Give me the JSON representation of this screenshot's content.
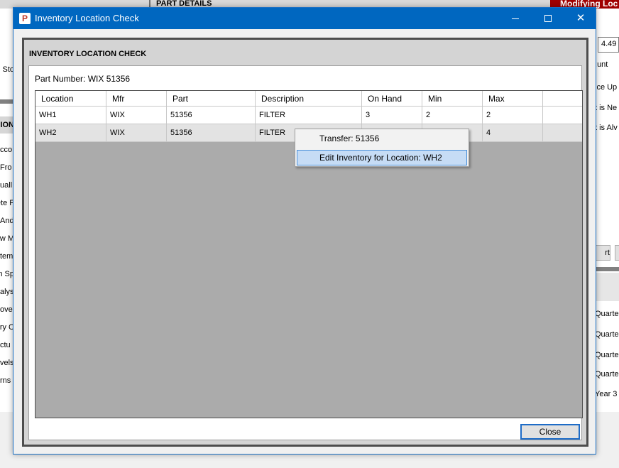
{
  "background": {
    "part_details_label": "PART DETAILS",
    "modifying_label": "Modifying Loc",
    "left_top_fragment": "o Sto",
    "left_header_fragment": "ION",
    "left_items": [
      "cco",
      "Fro",
      "uall",
      "ete F",
      "And",
      "w M",
      "tem",
      "n Sp",
      "alys",
      "ove",
      "ry C",
      "ctu",
      "vels",
      "rns"
    ],
    "right_input_value": "4.49",
    "right_items_top": [
      "unt:",
      "ice Up",
      "t is Ne",
      "t is Alv"
    ],
    "right_button_fragment": "rt",
    "right_items_bottom": [
      "Quarte",
      "Quarte",
      "Quarte",
      "Quarte",
      "Year 3"
    ]
  },
  "window": {
    "title": "Inventory Location Check",
    "icon_letter": "P",
    "minimize_label": "",
    "maximize_label": "",
    "close_glyph": "✕"
  },
  "dialog": {
    "section_title": "INVENTORY LOCATION CHECK",
    "part_number_label": "Part Number: WIX 51356",
    "close_button": "Close"
  },
  "grid": {
    "columns": [
      "Location",
      "Mfr",
      "Part",
      "Description",
      "On Hand",
      "Min",
      "Max",
      ""
    ],
    "rows": [
      [
        "WH1",
        "WIX",
        "51356",
        "FILTER",
        "3",
        "2",
        "2",
        ""
      ],
      [
        "WH2",
        "WIX",
        "51356",
        "FILTER",
        "",
        "",
        "4",
        ""
      ]
    ],
    "selected_row": 1
  },
  "context_menu": {
    "items": [
      "Transfer: 51356",
      "Edit Inventory for Location: WH2"
    ],
    "highlighted_index": 1
  }
}
